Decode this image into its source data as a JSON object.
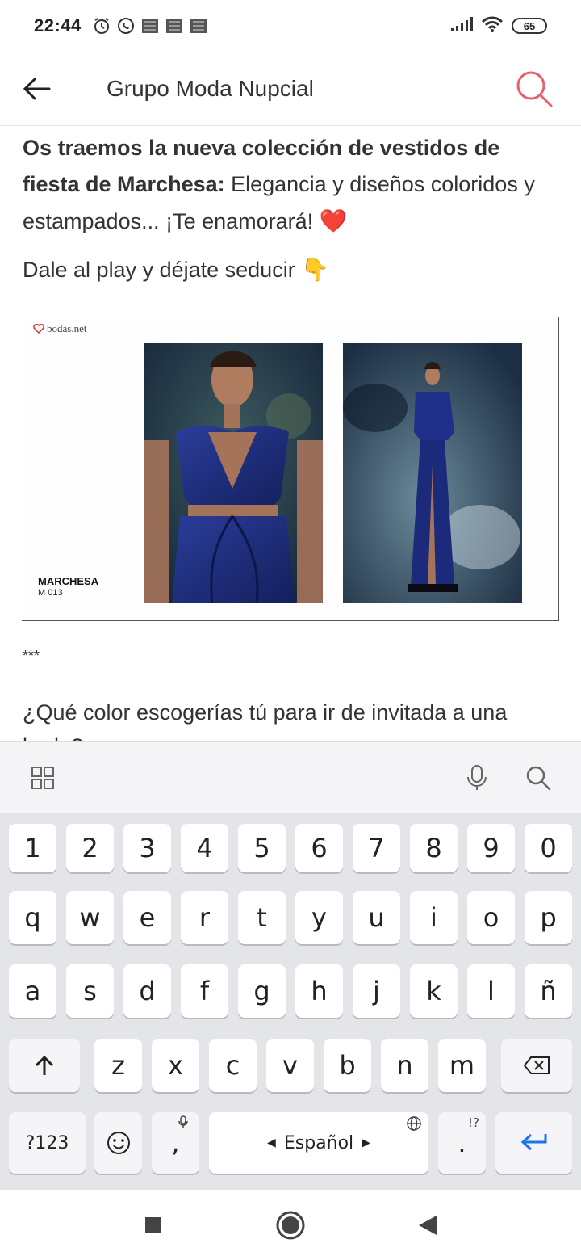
{
  "status_bar": {
    "time": "22:44",
    "battery": "65"
  },
  "app_bar": {
    "title": "Grupo Moda Nupcial"
  },
  "post": {
    "intro_bold": "Os traemos la nueva colección de vestidos de fiesta de Marchesa:",
    "intro_rest": " Elegancia y diseños coloridos y estampados... ¡Te enamorará! ",
    "intro_emoji": "❤️",
    "play_text": "Dale al play y déjate seducir ",
    "play_emoji": "👇",
    "image": {
      "logo": "bodas.net",
      "brand": "MARCHESA",
      "code": "M 013"
    },
    "separator": "***",
    "question": "¿Qué color escogerías tú para ir de invitada a una boda?"
  },
  "keyboard": {
    "row_numbers": [
      "1",
      "2",
      "3",
      "4",
      "5",
      "6",
      "7",
      "8",
      "9",
      "0"
    ],
    "row1": [
      "q",
      "w",
      "e",
      "r",
      "t",
      "y",
      "u",
      "i",
      "o",
      "p"
    ],
    "row2": [
      "a",
      "s",
      "d",
      "f",
      "g",
      "h",
      "j",
      "k",
      "l",
      "ñ"
    ],
    "row3": [
      "z",
      "x",
      "c",
      "v",
      "b",
      "n",
      "m"
    ],
    "symbols_label": "?123",
    "comma": ",",
    "space_label": "Español",
    "period": ".",
    "period_sub": "!?"
  },
  "colors": {
    "accent": "#e8616b",
    "enter": "#1a73e8",
    "dress": "#1e2f7a"
  }
}
